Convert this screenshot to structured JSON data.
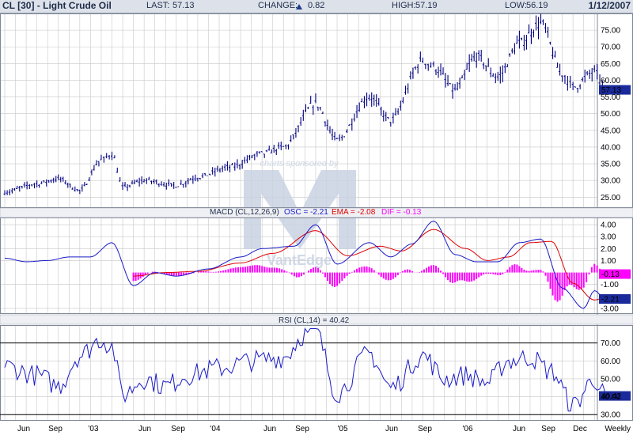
{
  "header": {
    "title": "CL [30] - Light Crude Oil",
    "last_label": "LAST:",
    "last": "57.13",
    "change_label": "CHANGE:",
    "change": "0.82",
    "high_label": "HIGH:",
    "high": "57.19",
    "low_label": "LOW:",
    "low": "56.19",
    "date": "1/12/2007"
  },
  "colors": {
    "price": "#000080",
    "macd": "#1a1ac8",
    "ema": "#e00000",
    "osc": "#ff00ff",
    "rsi": "#1a1ac8",
    "grid": "#c8c8c8",
    "header_bg": "#dde2ea",
    "watermark": "#c9d3e3"
  },
  "watermark": {
    "text1": "charts sponsored by",
    "text2": "VantEdge"
  },
  "x_axis": {
    "labels": [
      "Jun",
      "Sep",
      "'03",
      "Jun",
      "Sep",
      "'04",
      "Jun",
      "Sep",
      "'05",
      "Jun",
      "Sep",
      "'06",
      "Jun",
      "Sep",
      "Dec"
    ],
    "period": "Weekly"
  },
  "chart_data": [
    {
      "type": "candlestick",
      "title": "CL [30] - Light Crude Oil",
      "ylim": [
        22,
        80
      ],
      "y_ticks": [
        "25.00",
        "30.00",
        "35.00",
        "40.00",
        "45.00",
        "50.00",
        "55.00",
        "60.00",
        "65.00",
        "70.00",
        "75.00"
      ],
      "last_value": "57.13",
      "anchors": [
        {
          "x": "2002-05",
          "y": 26.5
        },
        {
          "x": "2002-08",
          "y": 29.0
        },
        {
          "x": "2002-10",
          "y": 30.5
        },
        {
          "x": "2002-12",
          "y": 27.0
        },
        {
          "x": "2003-02",
          "y": 36.0
        },
        {
          "x": "2003-03",
          "y": 38.0
        },
        {
          "x": "2003-04",
          "y": 28.0
        },
        {
          "x": "2003-06",
          "y": 30.0
        },
        {
          "x": "2003-09",
          "y": 28.5
        },
        {
          "x": "2003-11",
          "y": 31.0
        },
        {
          "x": "2004-02",
          "y": 34.0
        },
        {
          "x": "2004-05",
          "y": 38.0
        },
        {
          "x": "2004-07",
          "y": 40.0
        },
        {
          "x": "2004-10",
          "y": 53.0
        },
        {
          "x": "2004-12",
          "y": 42.0
        },
        {
          "x": "2005-03",
          "y": 55.0
        },
        {
          "x": "2005-05",
          "y": 48.0
        },
        {
          "x": "2005-08",
          "y": 66.0
        },
        {
          "x": "2005-09",
          "y": 64.0
        },
        {
          "x": "2005-11",
          "y": 57.0
        },
        {
          "x": "2006-01",
          "y": 67.0
        },
        {
          "x": "2006-03",
          "y": 61.0
        },
        {
          "x": "2006-05",
          "y": 71.0
        },
        {
          "x": "2006-07",
          "y": 77.0
        },
        {
          "x": "2006-09",
          "y": 62.0
        },
        {
          "x": "2006-10",
          "y": 58.0
        },
        {
          "x": "2006-12",
          "y": 62.5
        },
        {
          "x": "2007-01",
          "y": 57.13
        }
      ]
    },
    {
      "type": "line",
      "title": "MACD (CL,12,26,9)",
      "legend": [
        {
          "label": "OSC = -2.21",
          "color": "#1a1ac8"
        },
        {
          "label": "EMA = -2.08",
          "color": "#e00000"
        },
        {
          "label": "DIF = -0.13",
          "color": "#ff00ff"
        }
      ],
      "ylim": [
        -3.4,
        4.6
      ],
      "y_ticks": [
        "4.00",
        "3.00",
        "2.00",
        "1.00",
        "-1.00",
        "-3.00"
      ],
      "value_labels": [
        "-0.13",
        "-2.21"
      ],
      "series": [
        {
          "name": "OSC",
          "values_at": [
            {
              "x": "2002-05",
              "y": 1.2
            },
            {
              "x": "2002-07",
              "y": 0.9
            },
            {
              "x": "2002-09",
              "y": 1.0
            },
            {
              "x": "2002-11",
              "y": 1.3
            },
            {
              "x": "2003-01",
              "y": 1.3
            },
            {
              "x": "2003-03",
              "y": 2.5
            },
            {
              "x": "2003-05",
              "y": -1.1
            },
            {
              "x": "2003-07",
              "y": 0.0
            },
            {
              "x": "2003-09",
              "y": -0.3
            },
            {
              "x": "2003-12",
              "y": 0.3
            },
            {
              "x": "2004-03",
              "y": 1.3
            },
            {
              "x": "2004-05",
              "y": 2.0
            },
            {
              "x": "2004-08",
              "y": 2.2
            },
            {
              "x": "2004-10",
              "y": 4.0
            },
            {
              "x": "2004-12",
              "y": 0.7
            },
            {
              "x": "2005-03",
              "y": 2.5
            },
            {
              "x": "2005-05",
              "y": 1.3
            },
            {
              "x": "2005-07",
              "y": 2.4
            },
            {
              "x": "2005-09",
              "y": 4.3
            },
            {
              "x": "2005-11",
              "y": 1.5
            },
            {
              "x": "2006-01",
              "y": 0.9
            },
            {
              "x": "2006-03",
              "y": 0.9
            },
            {
              "x": "2006-05",
              "y": 2.5
            },
            {
              "x": "2006-07",
              "y": 2.8
            },
            {
              "x": "2006-09",
              "y": -1.3
            },
            {
              "x": "2006-11",
              "y": -3.0
            },
            {
              "x": "2006-12",
              "y": -1.5
            },
            {
              "x": "2007-01",
              "y": -2.2
            }
          ]
        },
        {
          "name": "EMA",
          "values_at": [
            {
              "x": "2003-05",
              "y": -0.3
            },
            {
              "x": "2003-08",
              "y": 0.0
            },
            {
              "x": "2003-11",
              "y": 0.1
            },
            {
              "x": "2004-03",
              "y": 0.8
            },
            {
              "x": "2004-06",
              "y": 1.6
            },
            {
              "x": "2004-10",
              "y": 3.5
            },
            {
              "x": "2005-01",
              "y": 1.4
            },
            {
              "x": "2005-04",
              "y": 2.2
            },
            {
              "x": "2005-06",
              "y": 1.8
            },
            {
              "x": "2005-09",
              "y": 3.6
            },
            {
              "x": "2005-12",
              "y": 2.0
            },
            {
              "x": "2006-02",
              "y": 1.0
            },
            {
              "x": "2006-04",
              "y": 1.3
            },
            {
              "x": "2006-06",
              "y": 2.5
            },
            {
              "x": "2006-08",
              "y": 2.6
            },
            {
              "x": "2006-10",
              "y": -0.9
            },
            {
              "x": "2006-12",
              "y": -2.3
            },
            {
              "x": "2007-01",
              "y": -2.1
            }
          ]
        }
      ]
    },
    {
      "type": "line",
      "title": "RSI (CL,14) = 40.42",
      "ylim": [
        27,
        80
      ],
      "y_ticks": [
        "70.00",
        "60.00",
        "50.00",
        "40.00",
        "30.00"
      ],
      "reference_lines": [
        70,
        30
      ],
      "last_value": "40.42",
      "anchors": [
        {
          "x": "2002-05",
          "y": 57
        },
        {
          "x": "2002-08",
          "y": 52
        },
        {
          "x": "2002-10",
          "y": 46
        },
        {
          "x": "2002-12",
          "y": 63
        },
        {
          "x": "2003-02",
          "y": 72
        },
        {
          "x": "2003-03",
          "y": 68
        },
        {
          "x": "2003-04",
          "y": 41
        },
        {
          "x": "2003-06",
          "y": 50
        },
        {
          "x": "2003-08",
          "y": 46
        },
        {
          "x": "2003-10",
          "y": 52
        },
        {
          "x": "2004-01",
          "y": 56
        },
        {
          "x": "2004-04",
          "y": 60
        },
        {
          "x": "2004-07",
          "y": 62
        },
        {
          "x": "2004-09",
          "y": 75
        },
        {
          "x": "2004-10",
          "y": 76
        },
        {
          "x": "2004-12",
          "y": 42
        },
        {
          "x": "2005-03",
          "y": 64
        },
        {
          "x": "2005-05",
          "y": 45
        },
        {
          "x": "2005-08",
          "y": 63
        },
        {
          "x": "2005-10",
          "y": 50
        },
        {
          "x": "2005-12",
          "y": 52
        },
        {
          "x": "2006-02",
          "y": 48
        },
        {
          "x": "2006-04",
          "y": 60
        },
        {
          "x": "2006-06",
          "y": 62
        },
        {
          "x": "2006-08",
          "y": 54
        },
        {
          "x": "2006-10",
          "y": 35
        },
        {
          "x": "2006-12",
          "y": 50
        },
        {
          "x": "2007-01",
          "y": 40.42
        }
      ]
    }
  ]
}
